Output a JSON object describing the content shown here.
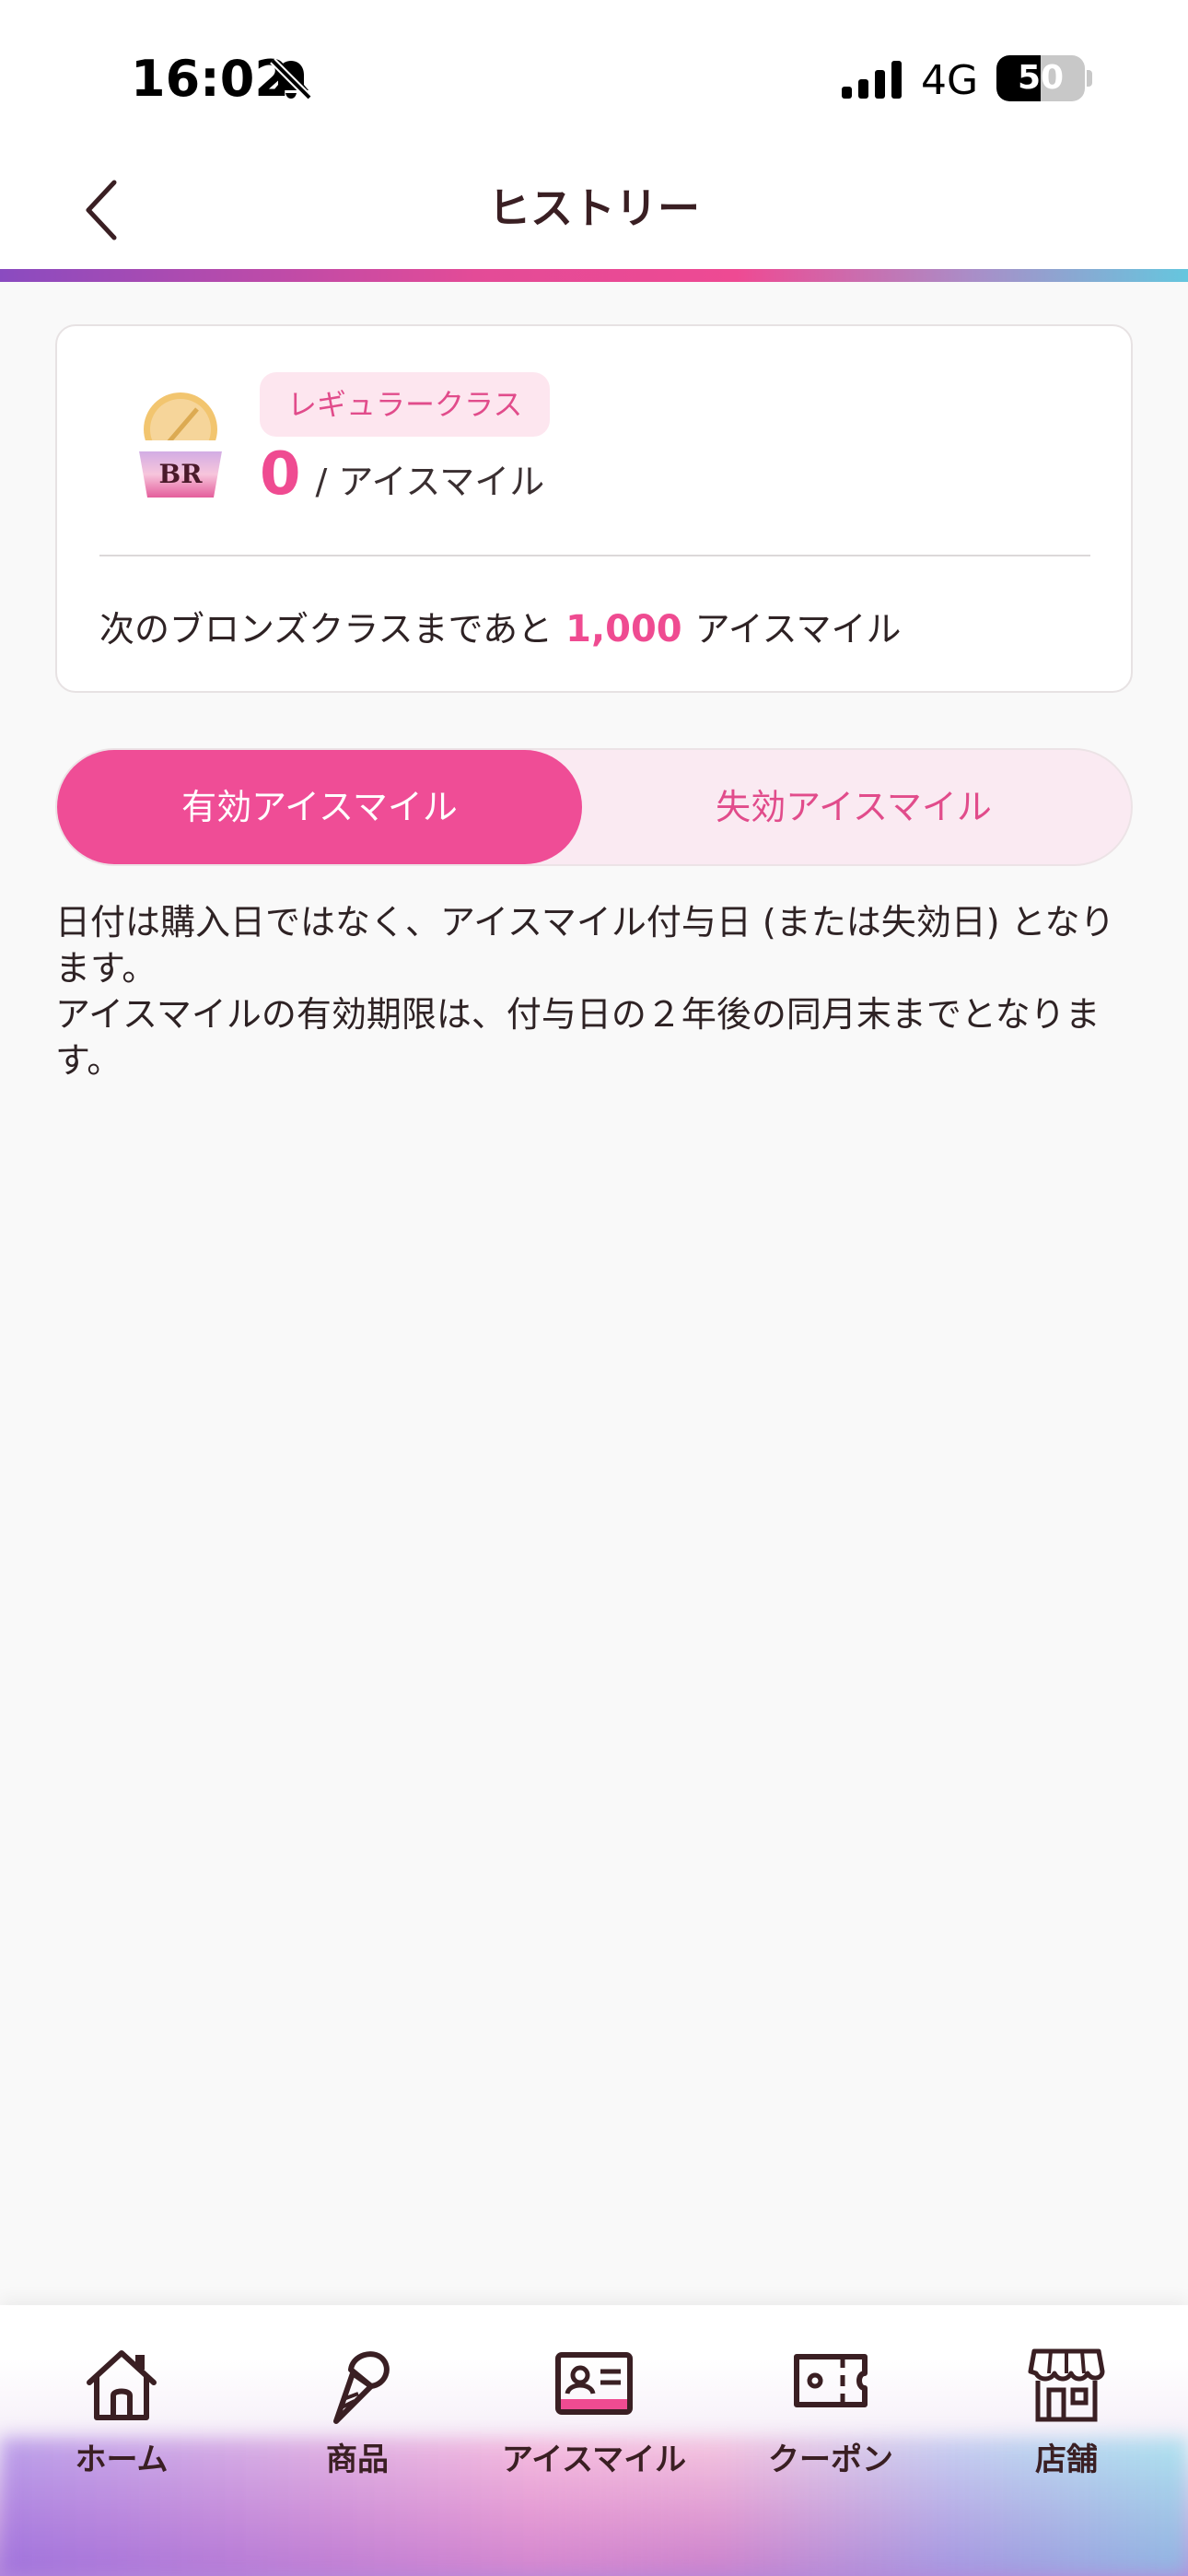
{
  "status_bar": {
    "time": "16:02",
    "network": "4G",
    "battery": "50",
    "battery_level": 0.5
  },
  "header": {
    "title": "ヒストリー"
  },
  "member_card": {
    "class_label": "レギュラークラス",
    "points": "0",
    "points_unit": "/ アイスマイル",
    "next_prefix": "次のブロンズクラスまであと",
    "next_amount": "1,000",
    "next_suffix": "アイスマイル",
    "logo_text": "BR"
  },
  "tabs": {
    "active_label": "有効アイスマイル",
    "inactive_label": "失効アイスマイル"
  },
  "notice": {
    "line1": "日付は購入日ではなく、アイスマイル付与日 (または失効日) となります。",
    "line2": "アイスマイルの有効期限は、付与日の２年後の同月末までとなります。"
  },
  "bottom_nav": {
    "items": [
      {
        "label": "ホーム",
        "icon": "home-icon"
      },
      {
        "label": "商品",
        "icon": "ice-cream-cone-icon"
      },
      {
        "label": "アイスマイル",
        "icon": "member-card-icon"
      },
      {
        "label": "クーポン",
        "icon": "ticket-icon"
      },
      {
        "label": "店舗",
        "icon": "store-icon"
      }
    ]
  },
  "colors": {
    "accent_pink": "#ef4b91",
    "badge_bg": "#fde6ef",
    "title_text": "#3a1f23"
  }
}
